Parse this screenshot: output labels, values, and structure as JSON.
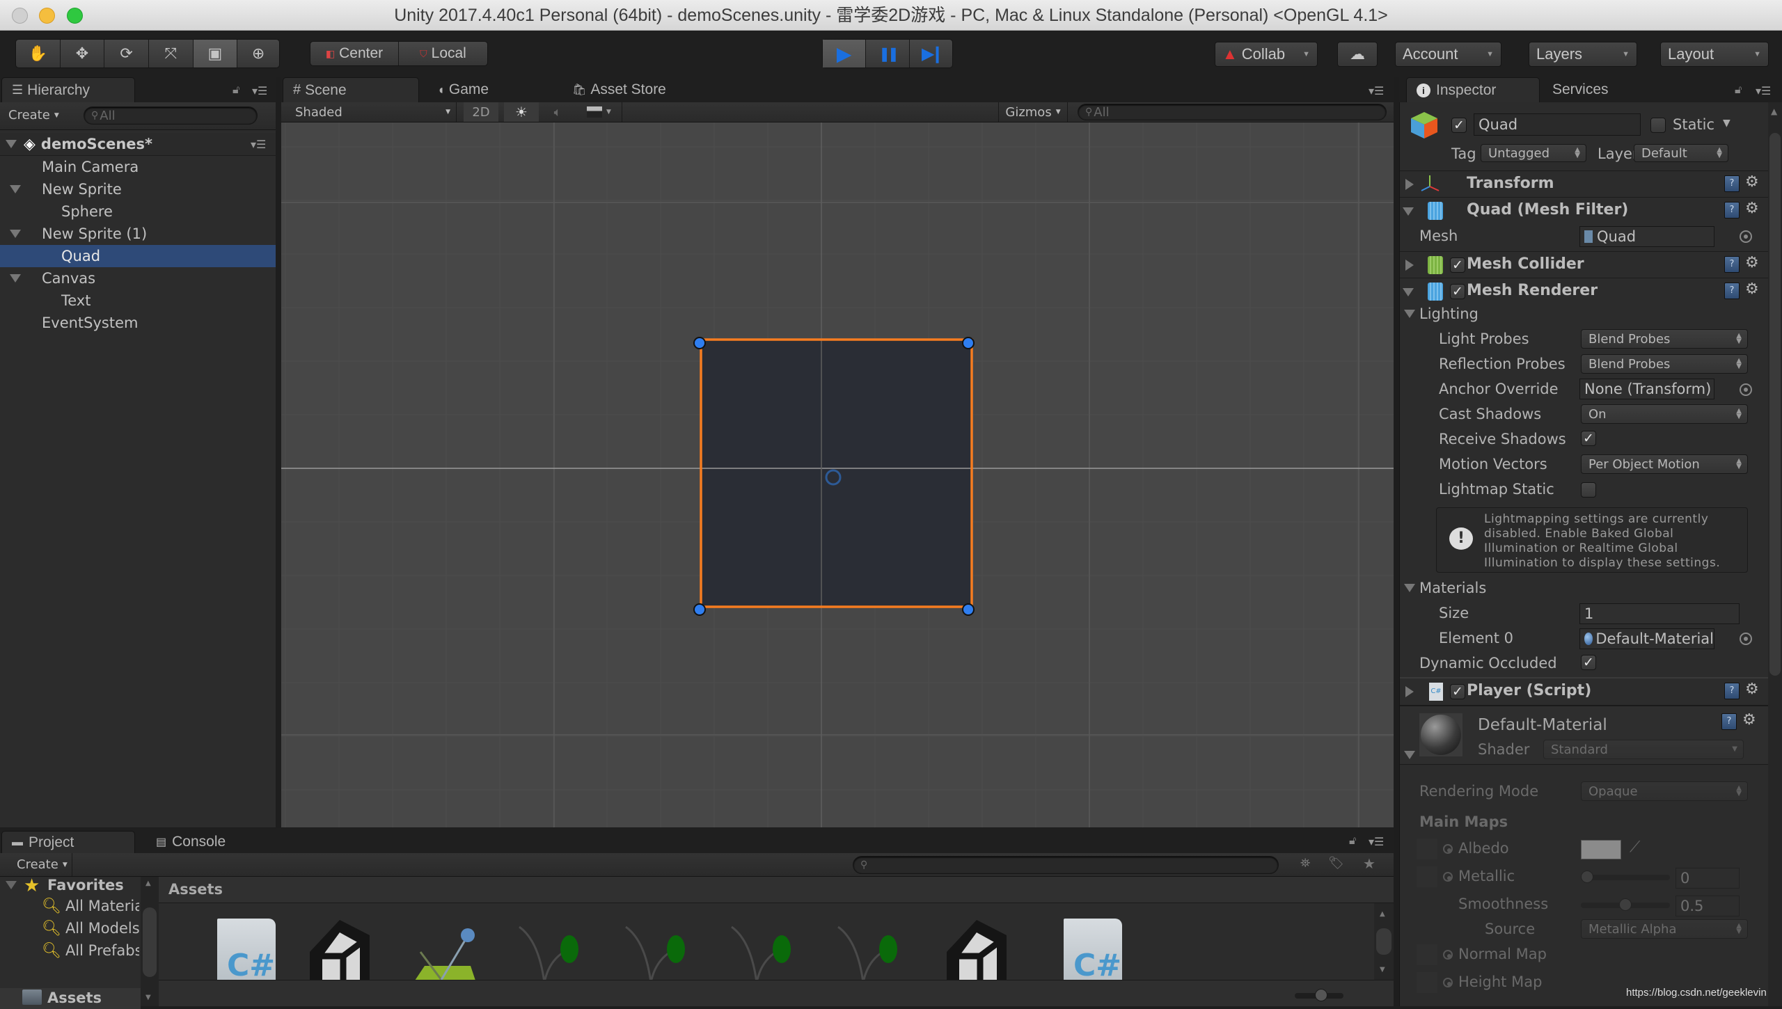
{
  "window": {
    "title": "Unity 2017.4.40c1 Personal (64bit) - demoScenes.unity - 雷学委2D游戏 - PC, Mac & Linux Standalone (Personal) <OpenGL 4.1>"
  },
  "toolbar": {
    "tools": [
      {
        "name": "hand-tool",
        "glyph": "✋"
      },
      {
        "name": "move-tool",
        "glyph": "✥"
      },
      {
        "name": "rotate-tool",
        "glyph": "⟳"
      },
      {
        "name": "scale-tool",
        "glyph": "⤧"
      },
      {
        "name": "rect-tool",
        "glyph": "▣"
      },
      {
        "name": "transform-tool",
        "glyph": "⊕"
      }
    ],
    "active_tool": "rect-tool",
    "pivot_mode": "Center",
    "pivot_rotation": "Local",
    "play_controls": {
      "play": "▶",
      "pause": "❚❚",
      "step": "▶❙"
    },
    "collab_label": "Collab",
    "account_label": "Account",
    "layers_label": "Layers",
    "layout_label": "Layout",
    "play_color": "#1a6fe0"
  },
  "hierarchy": {
    "tab_label": "Hierarchy",
    "create_label": "Create",
    "search_placeholder": "All",
    "scene_name": "demoScenes*",
    "items": [
      {
        "label": "Main Camera",
        "depth": 1,
        "expanded": null,
        "selected": false
      },
      {
        "label": "New Sprite",
        "depth": 1,
        "expanded": true,
        "selected": false
      },
      {
        "label": "Sphere",
        "depth": 2,
        "expanded": null,
        "selected": false
      },
      {
        "label": "New Sprite (1)",
        "depth": 1,
        "expanded": true,
        "selected": false
      },
      {
        "label": "Quad",
        "depth": 2,
        "expanded": null,
        "selected": true
      },
      {
        "label": "Canvas",
        "depth": 1,
        "expanded": true,
        "selected": false
      },
      {
        "label": "Text",
        "depth": 2,
        "expanded": null,
        "selected": false
      },
      {
        "label": "EventSystem",
        "depth": 1,
        "expanded": null,
        "selected": false
      }
    ]
  },
  "scene": {
    "tabs": [
      {
        "label": "Scene",
        "active": true
      },
      {
        "label": "Game",
        "active": false
      },
      {
        "label": "Asset Store",
        "active": false
      }
    ],
    "shading_mode": "Shaded",
    "mode_2d_label": "2D",
    "gizmos_label": "Gizmos",
    "search_placeholder": "All",
    "selection_color": "#f57c20",
    "handle_color": "#2f7ef0"
  },
  "inspector": {
    "tabs": [
      {
        "label": "Inspector",
        "active": true
      },
      {
        "label": "Services",
        "active": false
      }
    ],
    "object_active": true,
    "object_name": "Quad",
    "static_label": "Static",
    "static_checked": false,
    "tag_label": "Tag",
    "tag_value": "Untagged",
    "layer_label": "Layer",
    "layer_value": "Default",
    "components": {
      "transform": {
        "name": "Transform",
        "expanded": false
      },
      "mesh_filter": {
        "name": "Quad (Mesh Filter)",
        "expanded": true,
        "mesh_label": "Mesh",
        "mesh_value": "Quad"
      },
      "mesh_collider": {
        "name": "Mesh Collider",
        "enabled": true,
        "expanded": false
      },
      "mesh_renderer": {
        "name": "Mesh Renderer",
        "enabled": true,
        "expanded": true,
        "lighting_label": "Lighting",
        "props": {
          "light_probes": {
            "label": "Light Probes",
            "value": "Blend Probes"
          },
          "reflection_probes": {
            "label": "Reflection Probes",
            "value": "Blend Probes"
          },
          "anchor_override": {
            "label": "Anchor Override",
            "value": "None (Transform)"
          },
          "cast_shadows": {
            "label": "Cast Shadows",
            "value": "On"
          },
          "receive_shadows": {
            "label": "Receive Shadows",
            "checked": true
          },
          "motion_vectors": {
            "label": "Motion Vectors",
            "value": "Per Object Motion"
          },
          "lightmap_static": {
            "label": "Lightmap Static",
            "checked": false
          }
        },
        "info_message": "Lightmapping settings are currently disabled. Enable Baked Global Illumination or Realtime Global Illumination to display these settings.",
        "materials_label": "Materials",
        "size_label": "Size",
        "size_value": "1",
        "element0_label": "Element 0",
        "element0_value": "Default-Material",
        "dynamic_occluded_label": "Dynamic Occluded",
        "dynamic_occluded": true
      },
      "player_script": {
        "name": "Player (Script)",
        "enabled": true,
        "expanded": false
      },
      "material": {
        "name": "Default-Material",
        "shader_label": "Shader",
        "shader_value": "Standard",
        "rendering_mode_label": "Rendering Mode",
        "rendering_mode_value": "Opaque",
        "main_maps_label": "Main Maps",
        "albedo_label": "Albedo",
        "albedo_color": "#ffffff",
        "metallic_label": "Metallic",
        "metallic_value": "0",
        "metallic_fraction": 0,
        "smoothness_label": "Smoothness",
        "smoothness_value": "0.5",
        "smoothness_fraction": 0.5,
        "source_label": "Source",
        "source_value": "Metallic Alpha",
        "normal_map_label": "Normal Map",
        "height_map_label": "Height Map"
      }
    }
  },
  "project": {
    "tabs": [
      {
        "label": "Project",
        "active": true
      },
      {
        "label": "Console",
        "active": false
      }
    ],
    "create_label": "Create",
    "favorites_label": "Favorites",
    "favorites": [
      "All Materials",
      "All Models",
      "All Prefabs"
    ],
    "assets_root_label": "Assets",
    "breadcrumb": "Assets",
    "assets": [
      {
        "type": "csharp-script"
      },
      {
        "type": "unity-scene"
      },
      {
        "type": "physics-material-2d"
      },
      {
        "type": "animation-clip"
      },
      {
        "type": "animation-clip"
      },
      {
        "type": "animation-clip"
      },
      {
        "type": "animation-clip"
      },
      {
        "type": "unity-scene"
      },
      {
        "type": "csharp-script"
      }
    ],
    "icon_zoom_fraction": 0.55
  },
  "watermark": "https://blog.csdn.net/geeklevin"
}
